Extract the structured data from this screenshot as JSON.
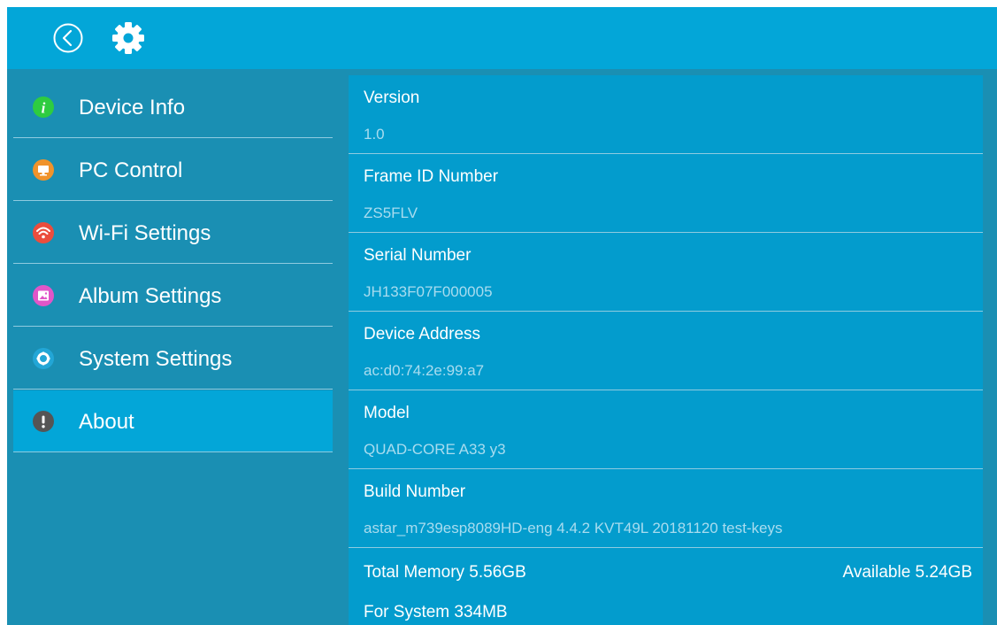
{
  "topbar": {
    "back_icon": "back-circle-icon",
    "settings_icon": "gear-icon"
  },
  "sidebar": {
    "items": [
      {
        "label": "Device Info",
        "icon": "info-icon",
        "icon_color": "#2ecc40",
        "active": false
      },
      {
        "label": "PC Control",
        "icon": "monitor-icon",
        "icon_color": "#f0932b",
        "active": false
      },
      {
        "label": "Wi-Fi Settings",
        "icon": "wifi-icon",
        "icon_color": "#eb4d3d",
        "active": false
      },
      {
        "label": "Album Settings",
        "icon": "image-icon",
        "icon_color": "#e056c8",
        "active": false
      },
      {
        "label": "System Settings",
        "icon": "gear-icon",
        "icon_color": "#22a6d6",
        "active": false
      },
      {
        "label": "About",
        "icon": "exclamation-icon",
        "icon_color": "#555555",
        "active": true
      }
    ]
  },
  "about": {
    "rows": [
      {
        "title": "Version",
        "value": "1.0"
      },
      {
        "title": "Frame ID Number",
        "value": "ZS5FLV"
      },
      {
        "title": "Serial Number",
        "value": "JH133F07F000005"
      },
      {
        "title": "Device Address",
        "value": "ac:d0:74:2e:99:a7"
      },
      {
        "title": "Model",
        "value": "QUAD-CORE A33 y3"
      },
      {
        "title": "Build Number",
        "value": "astar_m739esp8089HD-eng 4.4.2 KVT49L 20181120 test-keys"
      }
    ],
    "memory": {
      "total": "Total Memory 5.56GB",
      "available": "Available 5.24GB",
      "system": "For System 334MB"
    }
  },
  "colors": {
    "topbar": "#03a6d8",
    "background": "#1a8fb3",
    "panel": "#039ccd",
    "active_item": "#03a6d8"
  }
}
